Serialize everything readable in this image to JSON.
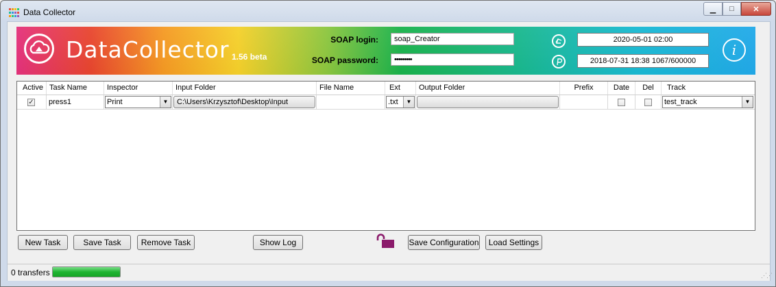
{
  "window": {
    "title": "Data Collector",
    "min_glyph": "▁",
    "max_glyph": "□",
    "close_glyph": "✕"
  },
  "banner": {
    "app_name": "DataCollector",
    "version": "1.56 beta",
    "soap_login_label": "SOAP login:",
    "soap_login_value": "soap_Creator",
    "soap_password_label": "SOAP password:",
    "soap_password_value": "•••••••••",
    "date1": "2020-05-01 02:00",
    "date2": "2018-07-31 18:38  1067/600000",
    "info_glyph": "i"
  },
  "grid": {
    "columns": [
      "Active",
      "Task Name",
      "Inspector",
      "Input Folder",
      "File Name",
      "Ext",
      "Output Folder",
      "Prefix",
      "Date",
      "Del",
      "Track"
    ],
    "rows": [
      {
        "active": "✓",
        "task_name": "press1",
        "inspector": "Print",
        "input_folder": "C:\\Users\\Krzysztof\\Desktop\\Input",
        "file_name": "",
        "ext": ".txt",
        "output_folder": "",
        "prefix": "",
        "date": "",
        "del": "",
        "track": "test_track"
      }
    ]
  },
  "buttons": {
    "new_task": "New Task",
    "save_task": "Save Task",
    "remove_task": "Remove Task",
    "show_log": "Show Log",
    "save_configuration": "Save Configuration",
    "load_settings": "Load Settings"
  },
  "status": {
    "transfers": "0 transfers",
    "progress": 1.0
  },
  "colors": {
    "lock": "#8b1a6b",
    "progress": "#1fb432",
    "close": "#c8463a"
  }
}
